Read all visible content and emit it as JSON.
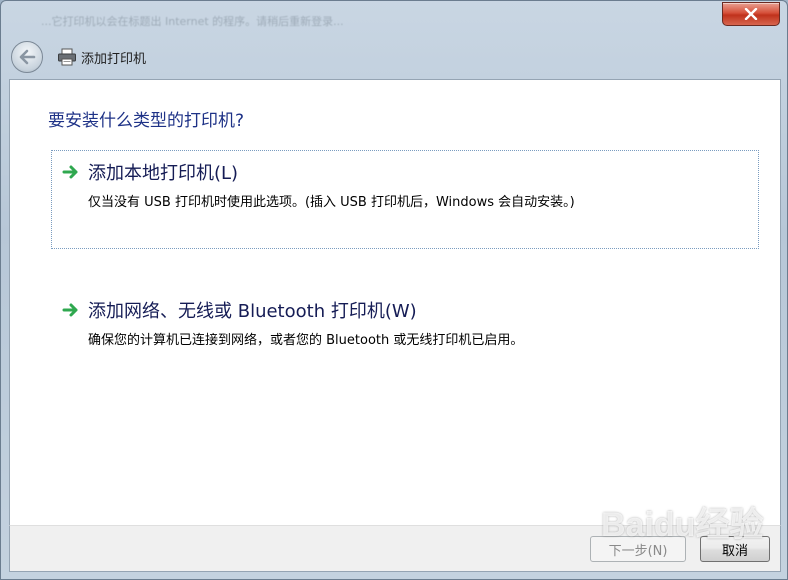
{
  "window": {
    "background_title": "...它打印机以会在标题出 Internet 的程序。请稍后重新登录...",
    "title": "添加打印机"
  },
  "main": {
    "heading": "要安装什么类型的打印机?",
    "options": [
      {
        "title": "添加本地打印机(L)",
        "description": "仅当没有 USB 打印机时使用此选项。(插入 USB 打印机后，Windows 会自动安装。)"
      },
      {
        "title": "添加网络、无线或 Bluetooth 打印机(W)",
        "description": "确保您的计算机已连接到网络，或者您的 Bluetooth 或无线打印机已启用。"
      }
    ]
  },
  "footer": {
    "next_label": "下一步(N)",
    "cancel_label": "取消"
  },
  "watermark": {
    "text": "Baidu经验"
  },
  "colors": {
    "heading": "#1e3287",
    "arrow_green": "#2fa84f",
    "close_red": "#c0321c"
  },
  "icons": {
    "close": "close-icon",
    "back": "back-arrow-icon",
    "printer": "printer-icon",
    "option_arrow": "green-arrow-icon"
  }
}
